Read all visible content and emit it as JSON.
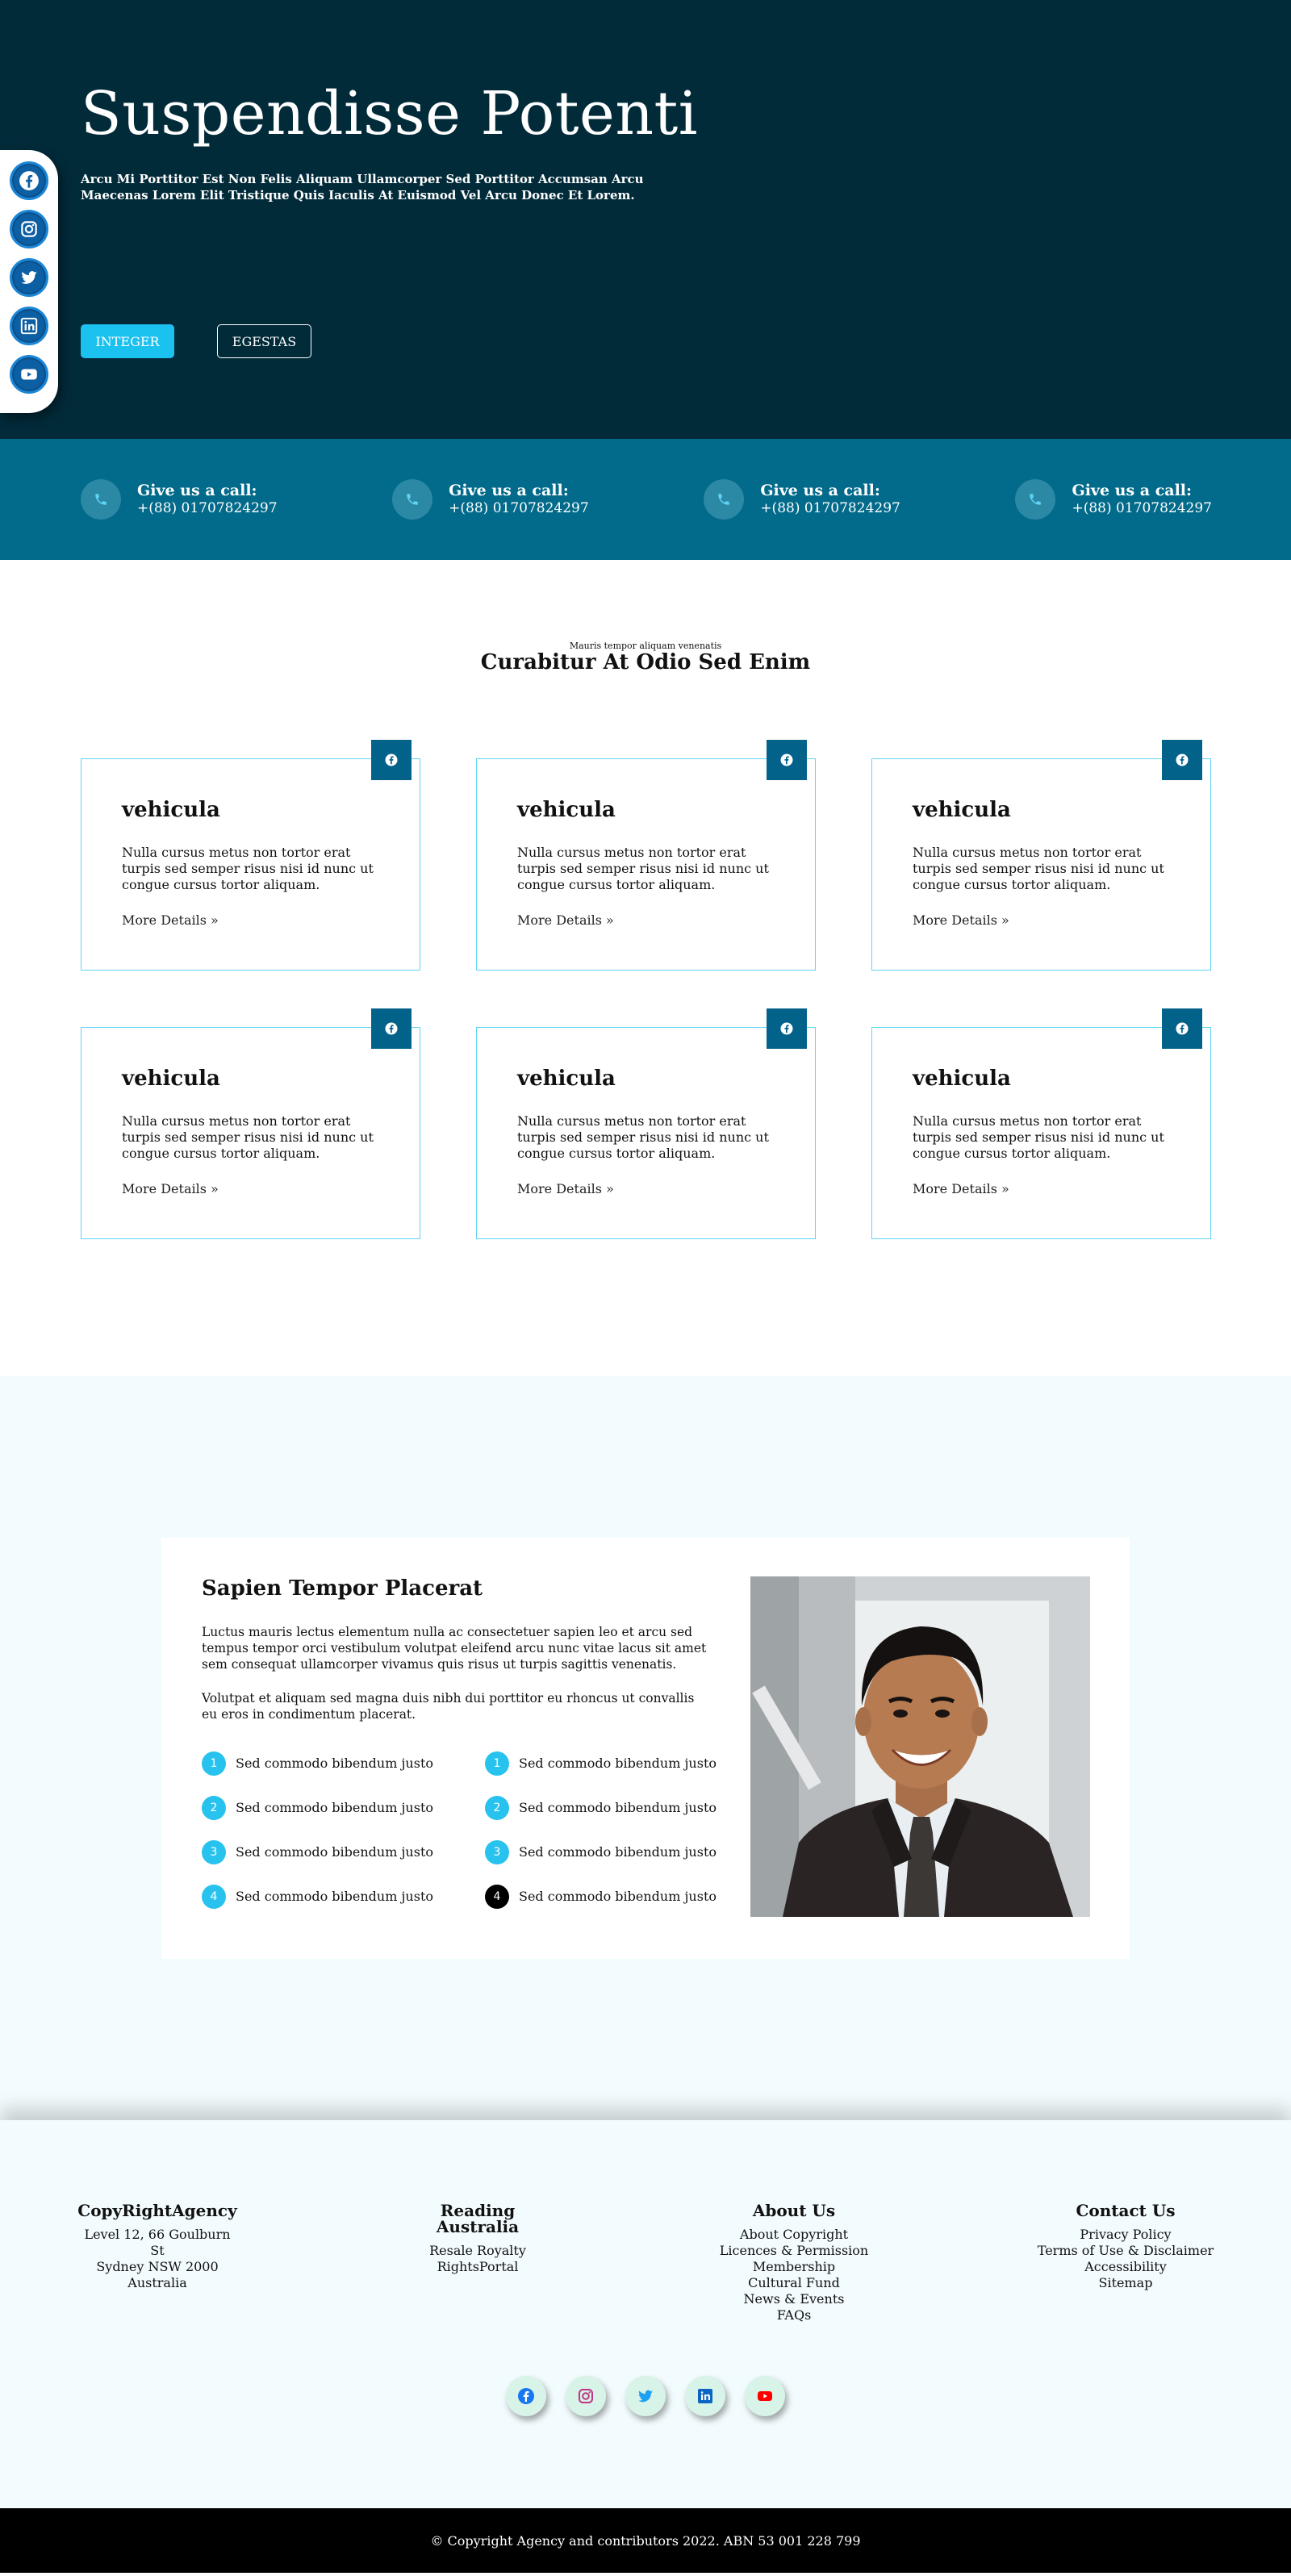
{
  "hero": {
    "title": "Suspendisse Potenti",
    "subtitle": "Arcu Mi Porttitor Est Non Felis Aliquam Ullamcorper Sed Porttitor Accumsan Arcu Maecenas Lorem Elit Tristique Quis Iaculis At Euismod Vel Arcu Donec Et Lorem.",
    "primary_button": "INTEGER",
    "secondary_button": "EGESTAS"
  },
  "side_social": [
    "facebook-icon",
    "instagram-icon",
    "twitter-icon",
    "linkedin-icon",
    "youtube-icon"
  ],
  "calls": [
    {
      "title": "Give us a call:",
      "number": "+(88) 01707824297"
    },
    {
      "title": "Give us a call:",
      "number": "+(88) 01707824297"
    },
    {
      "title": "Give us a call:",
      "number": "+(88) 01707824297"
    },
    {
      "title": "Give us a call:",
      "number": "+(88) 01707824297"
    }
  ],
  "services": {
    "eyebrow": "Mauris tempor aliquam venenatis",
    "heading": "Curabitur At Odio Sed Enim",
    "cards": [
      {
        "title": "vehicula",
        "text": "Nulla cursus metus non tortor erat turpis sed semper risus nisi id nunc ut congue cursus tortor aliquam.",
        "link": "More Details »"
      },
      {
        "title": "vehicula",
        "text": "Nulla cursus metus non tortor erat turpis sed semper risus nisi id nunc ut congue cursus tortor aliquam.",
        "link": "More Details »"
      },
      {
        "title": "vehicula",
        "text": "Nulla cursus metus non tortor erat turpis sed semper risus nisi id nunc ut congue cursus tortor aliquam.",
        "link": "More Details »"
      },
      {
        "title": "vehicula",
        "text": "Nulla cursus metus non tortor erat turpis sed semper risus nisi id nunc ut congue cursus tortor aliquam.",
        "link": "More Details »"
      },
      {
        "title": "vehicula",
        "text": "Nulla cursus metus non tortor erat turpis sed semper risus nisi id nunc ut congue cursus tortor aliquam.",
        "link": "More Details »"
      },
      {
        "title": "vehicula",
        "text": "Nulla cursus metus non tortor erat turpis sed semper risus nisi id nunc ut congue cursus tortor aliquam.",
        "link": "More Details »"
      }
    ]
  },
  "about": {
    "title": "Sapien Tempor Placerat",
    "paragraph1": "Luctus mauris lectus elementum nulla ac consectetuer sapien leo et arcu sed tempus tempor orci vestibulum volutpat eleifend arcu nunc vitae lacus sit amet sem consequat ullamcorper vivamus quis risus ut turpis sagittis venenatis.",
    "paragraph2": "Volutpat et aliquam sed magna duis nibh dui porttitor eu rhoncus ut convallis eu eros in condimentum placerat.",
    "list_left": [
      {
        "num": "1",
        "text": "Sed commodo bibendum justo"
      },
      {
        "num": "2",
        "text": "Sed commodo bibendum justo"
      },
      {
        "num": "3",
        "text": "Sed commodo bibendum justo"
      },
      {
        "num": "4",
        "text": "Sed commodo bibendum justo"
      }
    ],
    "list_right": [
      {
        "num": "1",
        "text": "Sed commodo bibendum justo"
      },
      {
        "num": "2",
        "text": "Sed commodo bibendum justo"
      },
      {
        "num": "3",
        "text": "Sed commodo bibendum justo"
      },
      {
        "num": "4",
        "text": "Sed commodo bibendum justo"
      }
    ]
  },
  "footer": {
    "columns": [
      {
        "heading": "CopyRightAgency",
        "lines": [
          "Level 12, 66 Goulburn St",
          "Sydney NSW 2000",
          "Australia"
        ]
      },
      {
        "heading": "Reading Australia",
        "lines": [
          "Resale Royalty",
          "RightsPortal"
        ]
      },
      {
        "heading": "About Us",
        "lines": [
          "About Copyright",
          "Licences & Permission",
          "Membership",
          "Cultural Fund",
          "News & Events",
          "FAQs"
        ]
      },
      {
        "heading": "Contact Us",
        "lines": [
          "Privacy Policy",
          "Terms of Use & Disclaimer",
          "Accessibility",
          "Sitemap"
        ]
      }
    ],
    "social": [
      "facebook-icon",
      "instagram-icon",
      "twitter-icon",
      "linkedin-icon",
      "youtube-icon"
    ]
  },
  "copyright": "© Copyright Agency and contributors 2022. ABN 53 001 228 799",
  "colors": {
    "hero_bg": "#022b3a",
    "strip_bg": "#026a8a",
    "accent": "#1bc1ef",
    "badge": "#03628a",
    "section_tint": "#f2fbfd"
  }
}
